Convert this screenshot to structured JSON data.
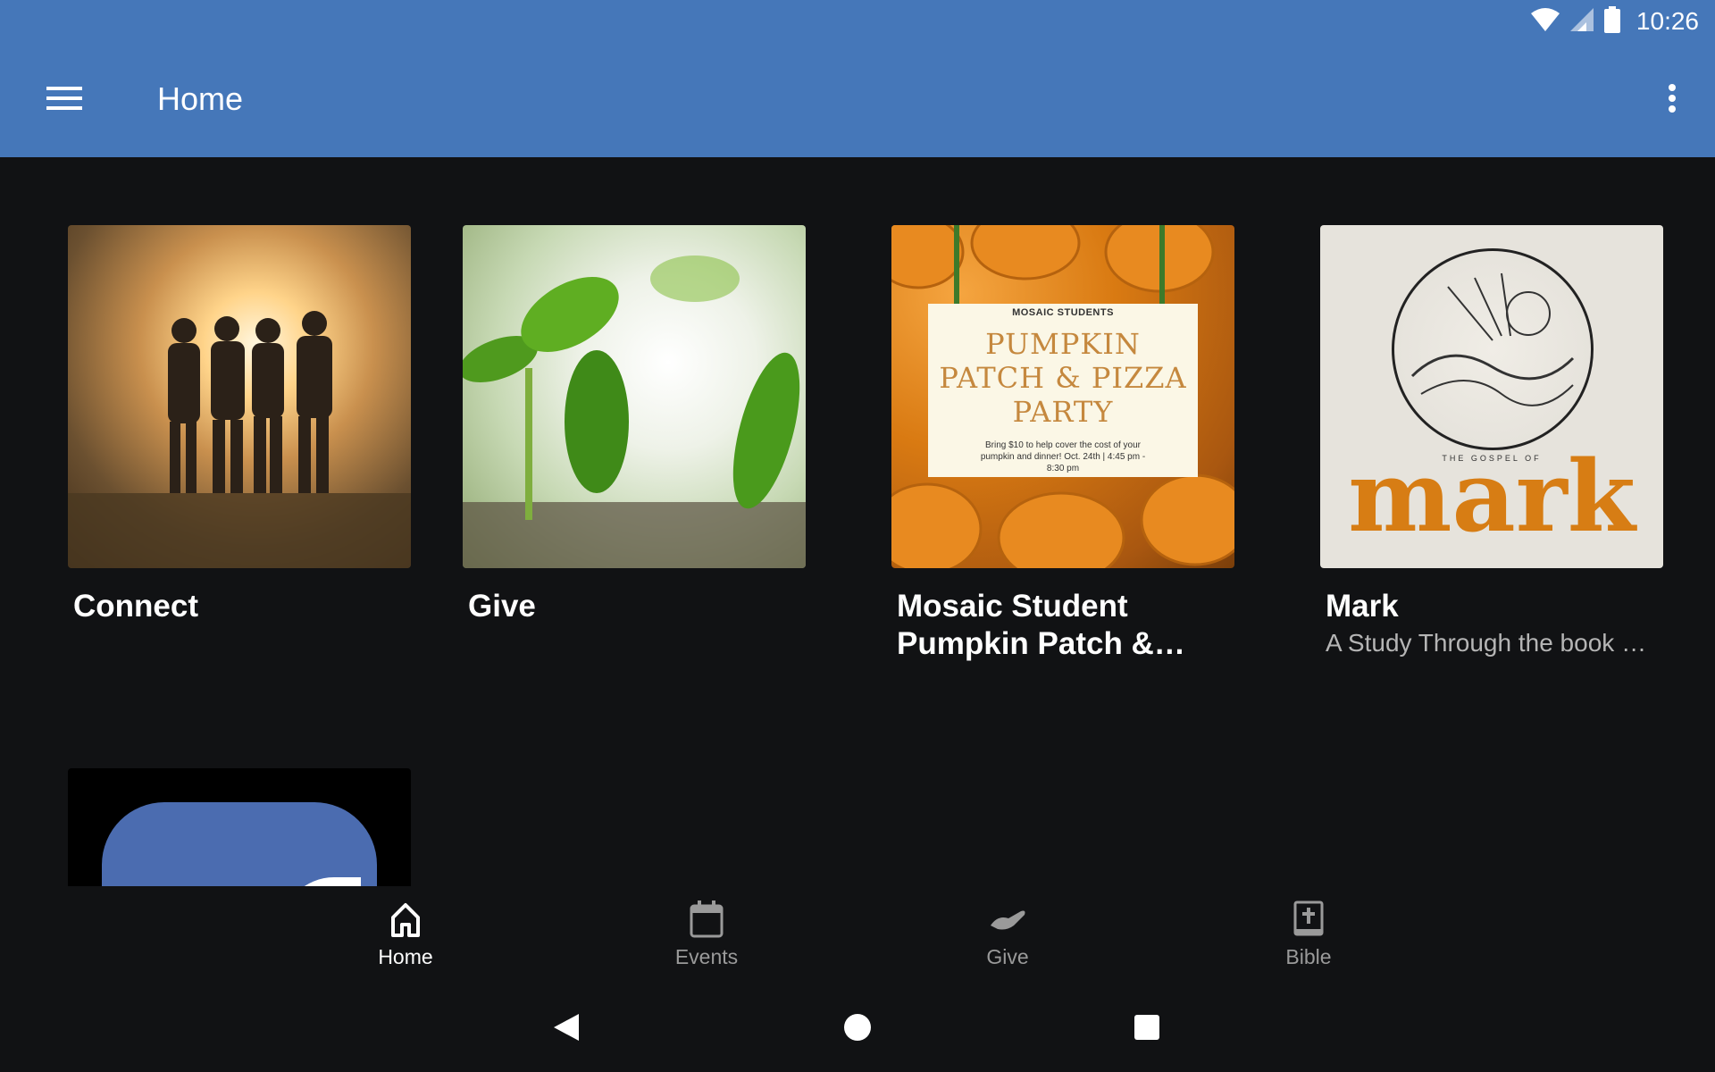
{
  "status_bar": {
    "time": "10:26",
    "icons": [
      "wifi-icon",
      "cell-signal-icon",
      "battery-icon"
    ]
  },
  "app_bar": {
    "title": "Home",
    "menu_icon": "hamburger-menu-icon",
    "overflow_icon": "more-vertical-icon",
    "color": "#4577b9"
  },
  "cards": [
    {
      "title": "Connect",
      "subtitle": ""
    },
    {
      "title": "Give",
      "subtitle": ""
    },
    {
      "title": "Mosaic Student Pumpkin Patch & Pizza Party",
      "subtitle": "",
      "image_text": {
        "header": "MOSAIC STUDENTS",
        "title": "PUMPKIN PATCH & PIZZA PARTY",
        "body": "Bring $10 to help cover the cost of your pumpkin and dinner! Oct. 24th | 4:45 pm - 8:30 pm"
      }
    },
    {
      "title": "Mark",
      "subtitle": "A Study Through the book of Mark",
      "image_text": {
        "small": "THE GOSPEL OF",
        "word": "mark"
      }
    },
    {
      "title": "",
      "subtitle": "",
      "image_icon": "facebook-logo-icon"
    }
  ],
  "bottom_nav": {
    "items": [
      {
        "label": "Home",
        "icon": "home-icon",
        "active": true
      },
      {
        "label": "Events",
        "icon": "calendar-icon",
        "active": false
      },
      {
        "label": "Give",
        "icon": "giving-hand-icon",
        "active": false
      },
      {
        "label": "Bible",
        "icon": "bible-icon",
        "active": false
      }
    ]
  },
  "system_nav": {
    "icons": [
      "back-icon",
      "home-circle-icon",
      "recents-square-icon"
    ]
  }
}
